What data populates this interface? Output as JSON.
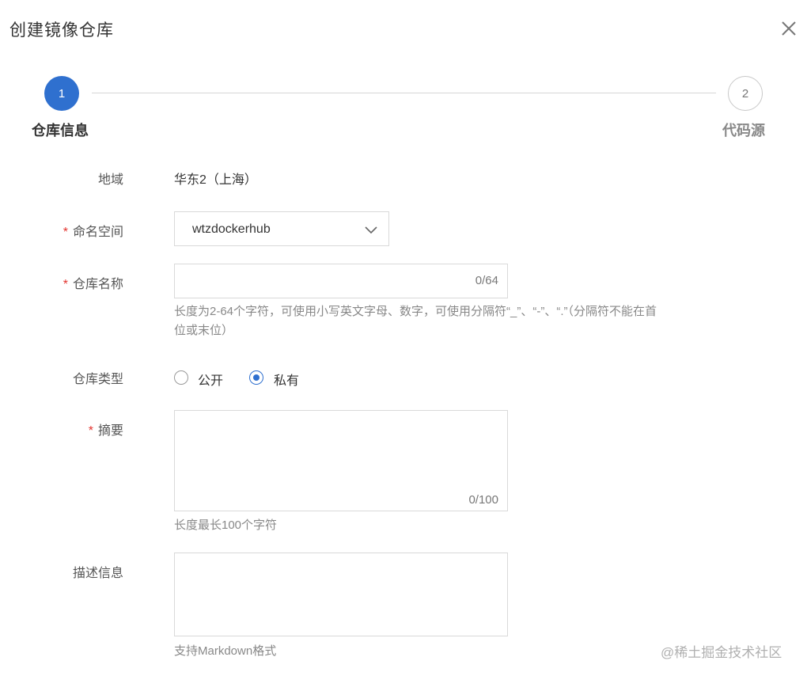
{
  "dialog": {
    "title": "创建镜像仓库",
    "close_icon": "close-icon"
  },
  "steps": [
    {
      "number": "1",
      "label": "仓库信息",
      "state": "active"
    },
    {
      "number": "2",
      "label": "代码源",
      "state": "inactive"
    }
  ],
  "form": {
    "region": {
      "label": "地域",
      "value": "华东2（上海）"
    },
    "namespace": {
      "label": "命名空间",
      "required": "*",
      "value": "wtzdockerhub"
    },
    "repo_name": {
      "label": "仓库名称",
      "required": "*",
      "value": "",
      "counter": "0/64",
      "hint_line1": "长度为2-64个字符，可使用小写英文字母、数字，可使用分隔符“_”、“-”、“.”（分隔符不能在首",
      "hint_line2": "位或末位）"
    },
    "repo_type": {
      "label": "仓库类型",
      "options": [
        {
          "label": "公开",
          "checked": false
        },
        {
          "label": "私有",
          "checked": true
        }
      ]
    },
    "summary": {
      "label": "摘要",
      "required": "*",
      "value": "",
      "counter": "0/100",
      "hint": "长度最长100个字符"
    },
    "description": {
      "label": "描述信息",
      "value": "",
      "hint": "支持Markdown格式"
    }
  },
  "colors": {
    "accent": "#2f70cf",
    "required": "#e3342f"
  },
  "watermark": "@稀土掘金技术社区"
}
